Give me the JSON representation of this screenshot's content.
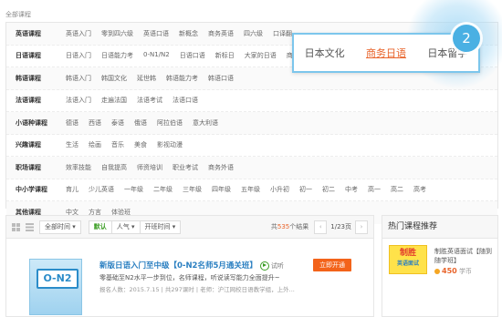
{
  "breadcrumb": "全部课程",
  "categories": [
    {
      "title": "英语课程",
      "items": [
        "英语入门",
        "零到四六级",
        "英语口语",
        "新概念",
        "商务英语",
        "四六级",
        "口译翻",
        "..."
      ]
    },
    {
      "title": "日语课程",
      "items": [
        "日语入门",
        "日语能力考",
        "0-N1/N2",
        "日语口语",
        "新标日",
        "大家的日语",
        "商务",
        "..."
      ]
    },
    {
      "title": "韩语课程",
      "items": [
        "韩语入门",
        "韩国文化",
        "延世韩",
        "韩语能力考",
        "韩语口语"
      ]
    },
    {
      "title": "法语课程",
      "items": [
        "法语入门",
        "走遍法国",
        "法语考试",
        "法语口语"
      ]
    },
    {
      "title": "小语种课程",
      "items": [
        "德语",
        "西语",
        "泰语",
        "俄语",
        "阿拉伯语",
        "意大利语"
      ]
    },
    {
      "title": "兴趣课程",
      "items": [
        "生活",
        "绘画",
        "音乐",
        "美食",
        "影视动漫"
      ]
    },
    {
      "title": "职场课程",
      "items": [
        "效率技能",
        "自我提高",
        "师资培训",
        "职业考试",
        "商务外语"
      ]
    },
    {
      "title": "中小学课程",
      "items": [
        "育儿",
        "少儿英语",
        "一年级",
        "二年级",
        "三年级",
        "四年级",
        "五年级",
        "小升初",
        "初一",
        "初二",
        "中考",
        "高一",
        "高二",
        "高考"
      ]
    },
    {
      "title": "其他课程",
      "items": [
        "中文",
        "方言",
        "体验班"
      ]
    }
  ],
  "popup": {
    "tabs": [
      "日本文化",
      "商务日语",
      "日本留学"
    ],
    "active_tab": "商务日语",
    "step_number": "2"
  },
  "toolbar": {
    "time_select": "全部时间 ▾",
    "sort_default": "默认",
    "sort_popular": "人气 ▾",
    "sort_time": "开班时间 ▾",
    "result_prefix": "共",
    "result_count": "535",
    "result_suffix": "个结果",
    "page_indicator": "1/23页",
    "prev_label": "‹",
    "next_label": "›"
  },
  "course": {
    "thumb_text": "O-N2",
    "title": "新版日语入门至中级【0-N2名师5月通关班】",
    "trial_label": "试听",
    "description": "零基础至N2水平一步到位，名师课程，听说读写能力全面提升~",
    "meta": "报名人数：2015.7.15 | 共297课时 | 老师：沪江网校日语教学组，上外...",
    "open_button": "立即开通"
  },
  "sidebar": {
    "title": "热门课程推荐",
    "item_thumb_line1": "制胜",
    "item_thumb_line2": "英语面试",
    "item_name": "制胜英语面试【随到随学班】",
    "price": "450",
    "price_unit": "学币"
  },
  "colors": {
    "accent_orange": "#f3631a",
    "link_blue": "#2a7fc1",
    "badge_blue": "#4ab0e3",
    "active_green": "#3a9d23"
  }
}
